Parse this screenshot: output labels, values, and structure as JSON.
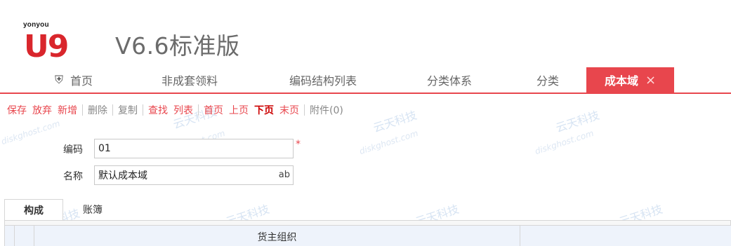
{
  "header": {
    "brand_small": "yonyou",
    "logo_text": "U9",
    "version_title": "V6.6标准版"
  },
  "tabs": [
    {
      "label": "首页",
      "icon": "home-icon"
    },
    {
      "label": "非成套领料"
    },
    {
      "label": "编码结构列表"
    },
    {
      "label": "分类体系"
    },
    {
      "label": "分类"
    },
    {
      "label": "成本域",
      "active": true,
      "close": "×"
    }
  ],
  "toolbar": {
    "save": "保存",
    "discard": "放弃",
    "add": "新增",
    "delete": "删除",
    "copy": "复制",
    "find": "查找",
    "list": "列表",
    "first": "首页",
    "prev": "上页",
    "next": "下页",
    "last": "末页",
    "attachment": "附件(0)"
  },
  "form": {
    "code_label": "编码",
    "code_value": "01",
    "required_mark": "*",
    "name_label": "名称",
    "name_value": "默认成本域",
    "name_suffix": "ab"
  },
  "subtabs": [
    "构成",
    "账簿"
  ],
  "grid": {
    "columns": [
      "",
      "",
      "货主组织",
      ""
    ]
  },
  "watermark": {
    "brand": "云天科技",
    "site": "diskghost.com"
  },
  "colors": {
    "accent": "#e8464d",
    "logo_red": "#d9262c"
  }
}
